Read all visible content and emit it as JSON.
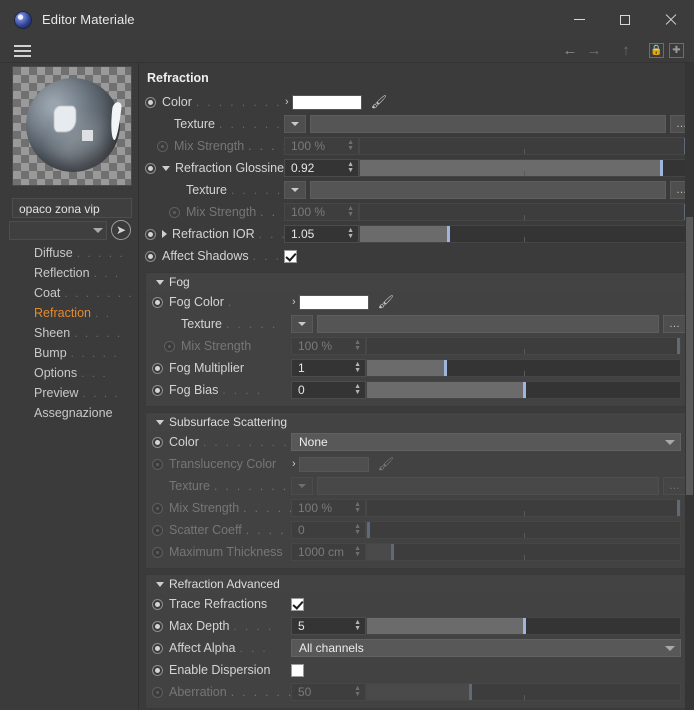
{
  "window": {
    "title": "Editor Materiale",
    "icon": "material-orb-icon",
    "minimize": "minimize",
    "maximize": "maximize",
    "close": "close"
  },
  "toolbar": {
    "menu_icon": "hamburger-menu-icon",
    "back_icon": "arrow-left-icon",
    "forward_icon": "arrow-right-icon",
    "up_icon": "arrow-up-icon",
    "lock_icon": "lock-icon",
    "pin_icon": "pin-plus-icon"
  },
  "sidebar": {
    "preview_name": "material-preview-sphere",
    "material_name": "opaco zona vip",
    "selector_value": "",
    "items": [
      {
        "label": "Diffuse",
        "dots": ". . . . .",
        "active": false
      },
      {
        "label": "Reflection",
        "dots": ". . .",
        "active": false
      },
      {
        "label": "Coat",
        "dots": ". . . . . . .",
        "active": false
      },
      {
        "label": "Refraction",
        "dots": ". .",
        "active": true
      },
      {
        "label": "Sheen",
        "dots": ". . . . .",
        "active": false
      },
      {
        "label": "Bump",
        "dots": ". . . . .",
        "active": false
      },
      {
        "label": "Options",
        "dots": ". . .",
        "active": false
      },
      {
        "label": "Preview",
        "dots": ". . . .",
        "active": false
      },
      {
        "label": "Assegnazione",
        "dots": "",
        "active": false
      }
    ]
  },
  "main": {
    "title": "Refraction",
    "rows": [
      {
        "name": "color",
        "label": "Color",
        "dots": ". . . . . . . . . .",
        "type": "color",
        "enabled": true,
        "indent": 0,
        "arrow": true,
        "swatch": "#ffffff",
        "pipette": true
      },
      {
        "name": "texture",
        "label": "Texture",
        "dots": ". . . . . . . . . . .",
        "type": "texture",
        "enabled": true,
        "indent": 1,
        "value": ""
      },
      {
        "name": "mix-strength",
        "label": "Mix Strength",
        "dots": ". . . . . . .",
        "type": "slider",
        "enabled": false,
        "indent": 1,
        "value": "100 %",
        "fill": 0,
        "handle": 99.3
      },
      {
        "name": "refraction-glossiness",
        "label": "Refraction Glossiness",
        "dots": "",
        "type": "slider",
        "enabled": true,
        "indent": 0,
        "collapse": "down",
        "value": "0.92",
        "fill": 92,
        "handle": 92
      },
      {
        "name": "glossiness-texture",
        "label": "Texture",
        "dots": ". . . . . . . . .",
        "type": "texture",
        "enabled": true,
        "indent": 2,
        "value": ""
      },
      {
        "name": "glossiness-mix-strength",
        "label": "Mix Strength",
        "dots": ". . . . .",
        "type": "slider",
        "enabled": false,
        "indent": 2,
        "value": "100 %",
        "fill": 0,
        "handle": 99.3
      },
      {
        "name": "refraction-ior",
        "label": "Refraction IOR",
        "dots": ". . . . .",
        "type": "slider",
        "enabled": true,
        "indent": 0,
        "collapse": "right",
        "value": "1.05",
        "fill": 27,
        "handle": 27
      },
      {
        "name": "affect-shadows",
        "label": "Affect Shadows",
        "dots": ". . . . . .",
        "type": "checkbox",
        "enabled": true,
        "indent": 0,
        "checked": true
      }
    ],
    "groups": [
      {
        "name": "fog",
        "title": "Fog",
        "rows": [
          {
            "name": "fog-color",
            "label": "Fog Color",
            "dots": ".",
            "type": "color",
            "enabled": true,
            "indent": 0,
            "arrow": true,
            "swatch": "#ffffff",
            "pipette": true
          },
          {
            "name": "fog-texture",
            "label": "Texture",
            "dots": ". . . . .",
            "type": "texture",
            "enabled": true,
            "indent": 1,
            "value": ""
          },
          {
            "name": "fog-mix-strength",
            "label": "Mix Strength",
            "dots": "",
            "type": "slider",
            "enabled": false,
            "indent": 1,
            "value": "100 %",
            "fill": 0,
            "handle": 99.3
          },
          {
            "name": "fog-multiplier",
            "label": "Fog Multiplier",
            "dots": "",
            "type": "slider",
            "enabled": true,
            "indent": 0,
            "value": "1",
            "fill": 25,
            "handle": 25
          },
          {
            "name": "fog-bias",
            "label": "Fog Bias",
            "dots": ". . . .",
            "type": "slider",
            "enabled": true,
            "indent": 0,
            "value": "0",
            "fill": 50,
            "handle": 50
          }
        ]
      },
      {
        "name": "subsurface-scattering",
        "title": "Subsurface Scattering",
        "rows": [
          {
            "name": "sss-color",
            "label": "Color",
            "dots": ". . . . . . . . . .",
            "type": "combo",
            "enabled": true,
            "indent": 0,
            "value": "None"
          },
          {
            "name": "translucency-color",
            "label": "Translucency Color",
            "dots": "",
            "type": "color",
            "enabled": false,
            "indent": 0,
            "arrow": true,
            "swatch": "",
            "pipette": true
          },
          {
            "name": "sss-texture",
            "label": "Texture",
            "dots": ". . . . . . . . . . .",
            "type": "texture",
            "enabled": false,
            "indent": 0,
            "value": ""
          },
          {
            "name": "sss-mix-strength",
            "label": "Mix Strength",
            "dots": ". . . . . .",
            "type": "slider",
            "enabled": false,
            "indent": 0,
            "value": "100 %",
            "fill": 0,
            "handle": 99.3
          },
          {
            "name": "scatter-coeff",
            "label": "Scatter Coeff",
            "dots": ". . . . . .",
            "type": "slider",
            "enabled": false,
            "indent": 0,
            "value": "0",
            "fill": 0,
            "handle": 0.3
          },
          {
            "name": "maximum-thickness",
            "label": "Maximum Thickness",
            "dots": "",
            "type": "slider",
            "enabled": false,
            "indent": 0,
            "value": "1000 cm",
            "fill": 8,
            "handle": 8
          }
        ]
      },
      {
        "name": "refraction-advanced",
        "title": "Refraction Advanced",
        "rows": [
          {
            "name": "trace-refractions",
            "label": "Trace Refractions",
            "dots": "",
            "type": "checkbox",
            "enabled": true,
            "indent": 0,
            "checked": true
          },
          {
            "name": "max-depth",
            "label": "Max Depth",
            "dots": ". . . .",
            "type": "slider",
            "enabled": true,
            "indent": 0,
            "value": "5",
            "fill": 50,
            "handle": 50
          },
          {
            "name": "affect-alpha",
            "label": "Affect Alpha",
            "dots": ". . .",
            "type": "combo",
            "enabled": true,
            "indent": 0,
            "value": "All channels"
          },
          {
            "name": "enable-dispersion",
            "label": "Enable Dispersion",
            "dots": "",
            "type": "checkbox",
            "enabled": true,
            "indent": 0,
            "checked": false
          },
          {
            "name": "aberration",
            "label": "Aberration",
            "dots": ". . . . . .",
            "type": "slider",
            "enabled": false,
            "indent": 0,
            "value": "50",
            "fill": 33,
            "handle": 33
          }
        ]
      }
    ]
  },
  "colors": {
    "accent": "#e58a2a",
    "panel": "#3b3b3b",
    "group": "#424242",
    "slider_handle": "#9db6dd"
  }
}
